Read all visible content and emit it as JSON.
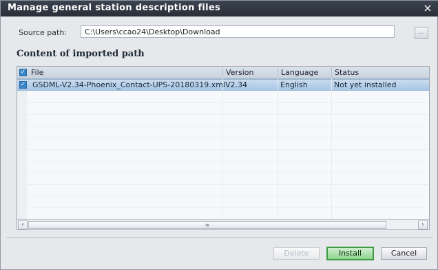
{
  "dialog": {
    "title": "Manage general station description files",
    "close_icon": "×"
  },
  "source": {
    "label": "Source path:",
    "value": "C:\\Users\\ccao24\\Desktop\\Download",
    "browse_icon": "..."
  },
  "section_title": "Content of imported path",
  "table": {
    "headers": {
      "file": "File",
      "version": "Version",
      "language": "Language",
      "status": "Status"
    },
    "rows": [
      {
        "file": "GSDML-V2.34-Phoenix_Contact-UPS-20180319.xml",
        "version": "V2.34",
        "language": "English",
        "status": "Not yet installed",
        "checked": true
      }
    ]
  },
  "scrollbar": {
    "left_arrow": "‹",
    "right_arrow": "›",
    "thumb_grip": "≡"
  },
  "buttons": {
    "delete": "Delete",
    "install": "Install",
    "cancel": "Cancel"
  },
  "colors": {
    "titlebar": "#2f3641",
    "selection": "#b7d0ea",
    "install_button": "#8fd38f"
  }
}
